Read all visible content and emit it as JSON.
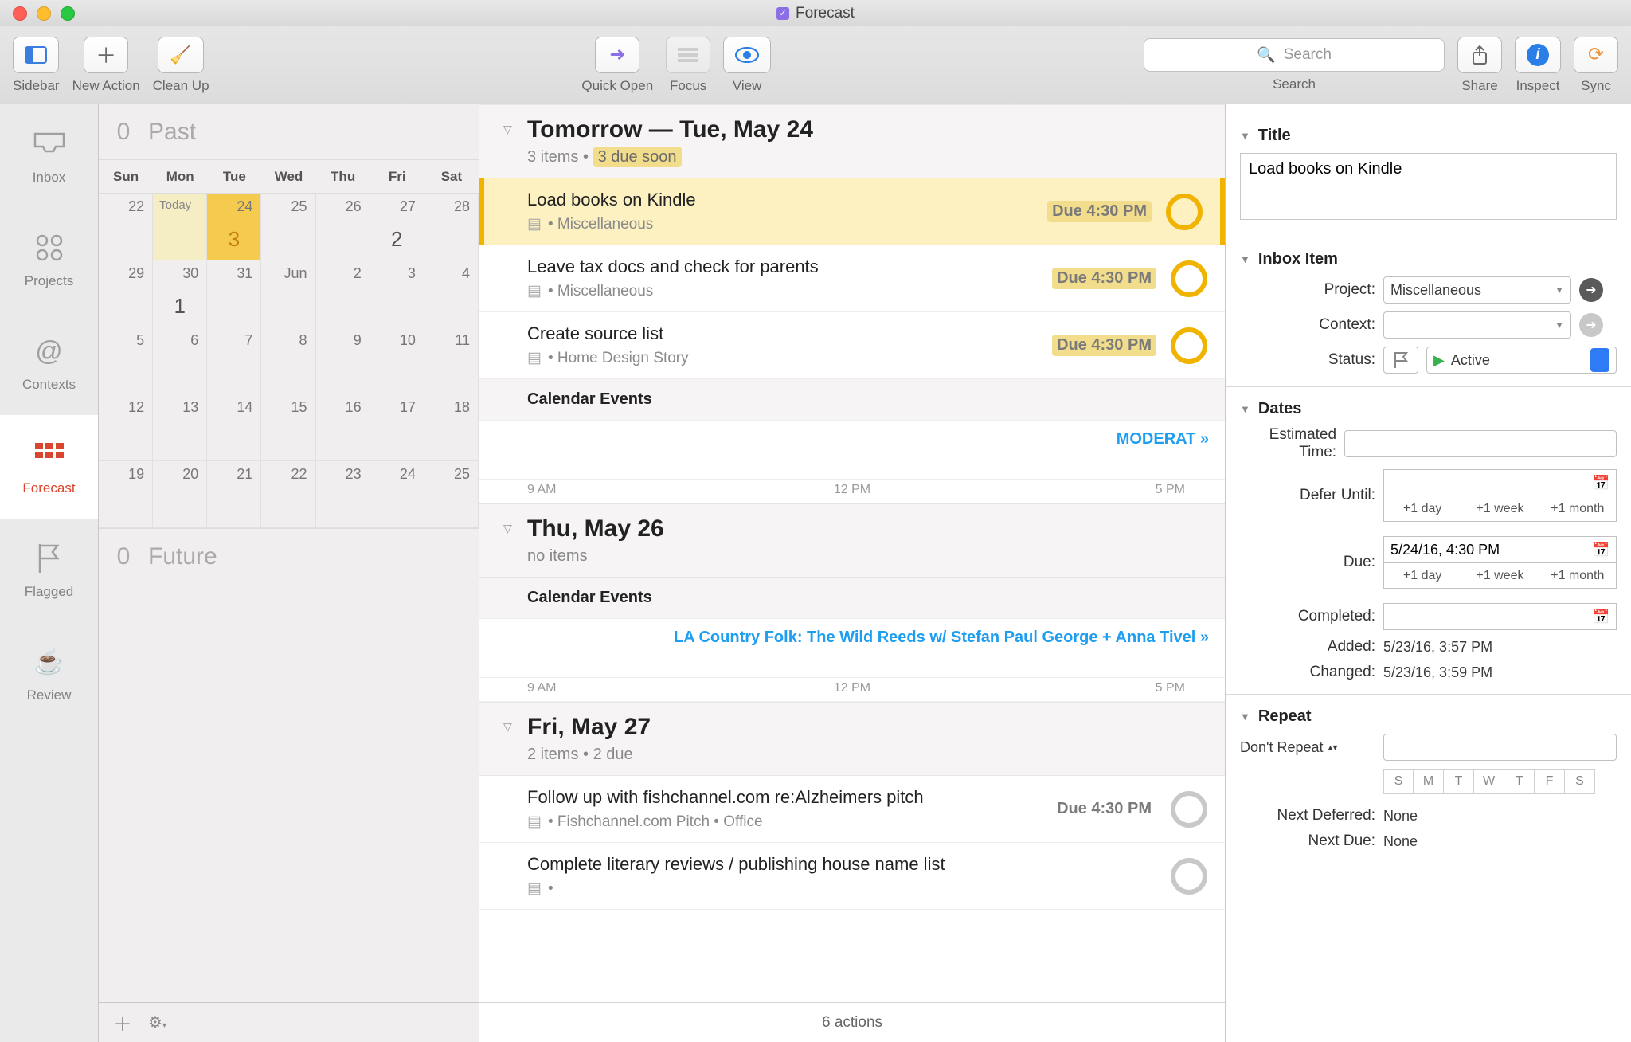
{
  "window": {
    "title": "Forecast"
  },
  "toolbar": {
    "sidebar": "Sidebar",
    "new_action": "New Action",
    "clean_up": "Clean Up",
    "quick_open": "Quick Open",
    "focus": "Focus",
    "view": "View",
    "search_label": "Search",
    "search_placeholder": "Search",
    "share": "Share",
    "inspect": "Inspect",
    "sync": "Sync"
  },
  "sidebar": {
    "items": [
      {
        "id": "inbox",
        "label": "Inbox"
      },
      {
        "id": "projects",
        "label": "Projects"
      },
      {
        "id": "contexts",
        "label": "Contexts"
      },
      {
        "id": "forecast",
        "label": "Forecast"
      },
      {
        "id": "flagged",
        "label": "Flagged"
      },
      {
        "id": "review",
        "label": "Review"
      }
    ],
    "active": "forecast"
  },
  "calendar": {
    "past_count": "0",
    "past_label": "Past",
    "future_count": "0",
    "future_label": "Future",
    "dow": [
      "Sun",
      "Mon",
      "Tue",
      "Wed",
      "Thu",
      "Fri",
      "Sat"
    ],
    "rows": [
      [
        {
          "n": "22"
        },
        {
          "n": "",
          "today": true,
          "today_lbl": "Today"
        },
        {
          "n": "24",
          "sel": true,
          "badge": "3"
        },
        {
          "n": "25"
        },
        {
          "n": "26",
          "badge": ""
        },
        {
          "n": "27",
          "badge": "2"
        },
        {
          "n": "28"
        }
      ],
      [
        {
          "n": "29"
        },
        {
          "n": "30",
          "badge": "1"
        },
        {
          "n": "31"
        },
        {
          "n": "Jun"
        },
        {
          "n": "2"
        },
        {
          "n": "3"
        },
        {
          "n": "4"
        }
      ],
      [
        {
          "n": "5"
        },
        {
          "n": "6"
        },
        {
          "n": "7"
        },
        {
          "n": "8"
        },
        {
          "n": "9"
        },
        {
          "n": "10"
        },
        {
          "n": "11"
        }
      ],
      [
        {
          "n": "12"
        },
        {
          "n": "13"
        },
        {
          "n": "14"
        },
        {
          "n": "15"
        },
        {
          "n": "16"
        },
        {
          "n": "17"
        },
        {
          "n": "18"
        }
      ],
      [
        {
          "n": "19"
        },
        {
          "n": "20"
        },
        {
          "n": "21"
        },
        {
          "n": "22"
        },
        {
          "n": "23"
        },
        {
          "n": "24"
        },
        {
          "n": "25"
        }
      ]
    ]
  },
  "list": {
    "sections": [
      {
        "title": "Tomorrow — Tue, May 24",
        "sub_count": "3 items",
        "sub_warn": "3 due soon",
        "tasks": [
          {
            "title": "Load books on Kindle",
            "project": "Miscellaneous",
            "due": "Due 4:30 PM",
            "selected": true,
            "warn": true
          },
          {
            "title": "Leave tax docs and check for parents",
            "project": "Miscellaneous",
            "due": "Due 4:30 PM",
            "warn": true
          },
          {
            "title": "Create source list",
            "project": "Home Design Story",
            "due": "Due 4:30 PM",
            "warn": true
          }
        ],
        "cal_header": "Calendar Events",
        "event": "MODERAT",
        "time_labels": [
          "9 AM",
          "12 PM",
          "5 PM"
        ]
      },
      {
        "title": "Thu, May 26",
        "sub_count": "no items",
        "tasks": [],
        "cal_header": "Calendar Events",
        "event": "LA Country Folk: The Wild Reeds w/ Stefan Paul George + Anna Tivel",
        "time_labels": [
          "9 AM",
          "12 PM",
          "5 PM"
        ]
      },
      {
        "title": "Fri, May 27",
        "sub_count": "2 items • 2 due",
        "tasks": [
          {
            "title": "Follow up with fishchannel.com re:Alzheimers pitch",
            "project": "Fishchannel.com Pitch • Office",
            "due": "Due 4:30 PM",
            "gray": true
          },
          {
            "title": "Complete literary reviews / publishing house name list",
            "project": "",
            "due": "",
            "gray": true
          }
        ]
      }
    ],
    "status": "6 actions"
  },
  "inspector": {
    "title_hdr": "Title",
    "title_val": "Load books on Kindle",
    "inbox_hdr": "Inbox Item",
    "project_lbl": "Project:",
    "project_val": "Miscellaneous",
    "context_lbl": "Context:",
    "context_val": "",
    "status_lbl": "Status:",
    "status_val": "Active",
    "dates_hdr": "Dates",
    "est_lbl": "Estimated Time:",
    "est_val": "",
    "defer_lbl": "Defer Until:",
    "defer_val": "",
    "due_lbl": "Due:",
    "due_val": "5/24/16, 4:30 PM",
    "quick": [
      "+1 day",
      "+1 week",
      "+1 month"
    ],
    "completed_lbl": "Completed:",
    "completed_val": "",
    "added_lbl": "Added:",
    "added_val": "5/23/16, 3:57 PM",
    "changed_lbl": "Changed:",
    "changed_val": "5/23/16, 3:59 PM",
    "repeat_hdr": "Repeat",
    "repeat_mode": "Don't Repeat",
    "repeat_val": "",
    "days": [
      "S",
      "M",
      "T",
      "W",
      "T",
      "F",
      "S"
    ],
    "next_def_lbl": "Next Deferred:",
    "next_def_val": "None",
    "next_due_lbl": "Next Due:",
    "next_due_val": "None"
  }
}
